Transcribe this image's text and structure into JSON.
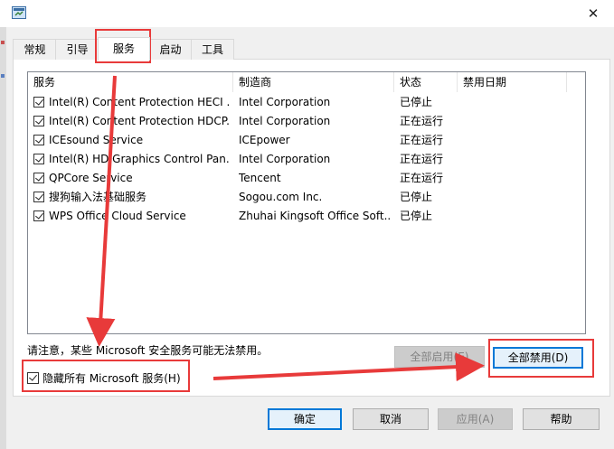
{
  "window": {
    "close_icon": "close-icon",
    "app_icon": "msconfig-icon"
  },
  "tabs": [
    "常规",
    "引导",
    "服务",
    "启动",
    "工具"
  ],
  "active_tab": "服务",
  "columns": [
    "服务",
    "制造商",
    "状态",
    "禁用日期"
  ],
  "services": [
    {
      "name": "Intel(R) Content Protection HECI ...",
      "vendor": "Intel Corporation",
      "status": "已停止",
      "checked": true
    },
    {
      "name": "Intel(R) Content Protection HDCP...",
      "vendor": "Intel Corporation",
      "status": "正在运行",
      "checked": true
    },
    {
      "name": "ICEsound Service",
      "vendor": "ICEpower",
      "status": "正在运行",
      "checked": true
    },
    {
      "name": "Intel(R) HD Graphics Control Pan...",
      "vendor": "Intel Corporation",
      "status": "正在运行",
      "checked": true
    },
    {
      "name": "QPCore Service",
      "vendor": "Tencent",
      "status": "正在运行",
      "checked": true
    },
    {
      "name": "搜狗输入法基础服务",
      "vendor": "Sogou.com Inc.",
      "status": "已停止",
      "checked": true
    },
    {
      "name": "WPS Office Cloud Service",
      "vendor": "Zhuhai Kingsoft Office Soft...",
      "status": "已停止",
      "checked": true
    }
  ],
  "note": "请注意，某些 Microsoft 安全服务可能无法禁用。",
  "hide_ms_label": "隐藏所有 Microsoft 服务(H)",
  "hide_ms_checked": true,
  "buttons": {
    "enable_all": "全部启用(E)",
    "disable_all": "全部禁用(D)",
    "ok": "确定",
    "cancel": "取消",
    "apply": "应用(A)",
    "help": "帮助"
  },
  "annotation_color": "#e83a3a"
}
